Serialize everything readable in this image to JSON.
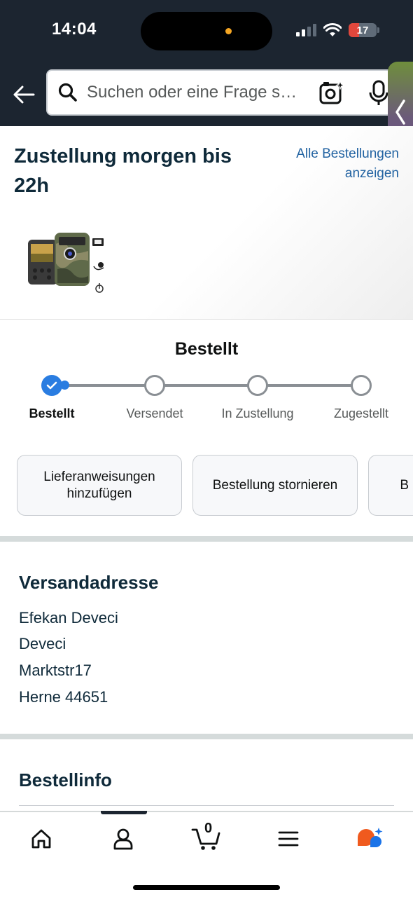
{
  "status_bar": {
    "time": "14:04",
    "battery": "17"
  },
  "search": {
    "placeholder": "Suchen oder eine Frage s…"
  },
  "icons": {
    "back": "arrow-left-icon",
    "search": "search-icon",
    "camera": "camera-search-icon",
    "mic": "microphone-icon",
    "side_tab": "chevron-left-icon"
  },
  "delivery": {
    "title": "Zustellung morgen bis 22h",
    "orders_link": "Alle Bestellungen\nanzeigen"
  },
  "tracker": {
    "heading": "Bestellt",
    "steps": [
      {
        "label": "Bestellt",
        "done": true
      },
      {
        "label": "Versendet",
        "done": false
      },
      {
        "label": "In Zustellung",
        "done": false
      },
      {
        "label": "Zugestellt",
        "done": false
      }
    ]
  },
  "actions": {
    "buttons": [
      {
        "label": "Lieferanweisungen hinzufügen"
      },
      {
        "label": "Bestellung stornieren"
      },
      {
        "label": "B"
      }
    ]
  },
  "address": {
    "title": "Versandadresse",
    "lines": [
      "Efekan Deveci",
      "Deveci",
      "Marktstr17",
      "Herne 44651"
    ]
  },
  "order_info": {
    "title": "Bestellinfo"
  },
  "bottom_nav": {
    "items": [
      "home-icon",
      "account-icon",
      "cart-icon",
      "menu-icon",
      "rufus-ai-icon"
    ],
    "cart_count": "0"
  },
  "colors": {
    "header_bg": "#1c2530",
    "link": "#2162a1",
    "progress": "#2a7de1",
    "heading_text": "#0f2a3a"
  }
}
